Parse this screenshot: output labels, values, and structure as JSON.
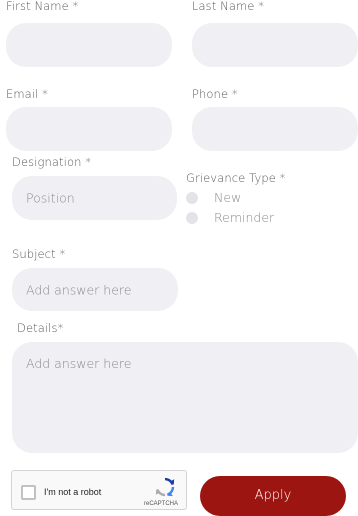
{
  "form": {
    "first_name": {
      "label": "First Name *",
      "value": ""
    },
    "last_name": {
      "label": "Last Name *",
      "value": ""
    },
    "email": {
      "label": "Email *",
      "value": ""
    },
    "phone": {
      "label": "Phone *",
      "value": ""
    },
    "designation": {
      "label": "Designation *",
      "placeholder": "Position"
    },
    "grievance_type": {
      "label": "Grievance Type *",
      "options": [
        "New",
        "Reminder"
      ]
    },
    "subject": {
      "label": "Subject *",
      "placeholder": "Add answer here"
    },
    "details": {
      "label": "Details*",
      "placeholder": "Add answer here"
    }
  },
  "captcha": {
    "label": "I'm not a robot",
    "brand": "reCAPTCHA"
  },
  "apply_button": {
    "label": "Apply"
  },
  "colors": {
    "field_bg": "#f0eff3",
    "radio_bg": "#e4e3e8",
    "accent": "#9c1510"
  }
}
